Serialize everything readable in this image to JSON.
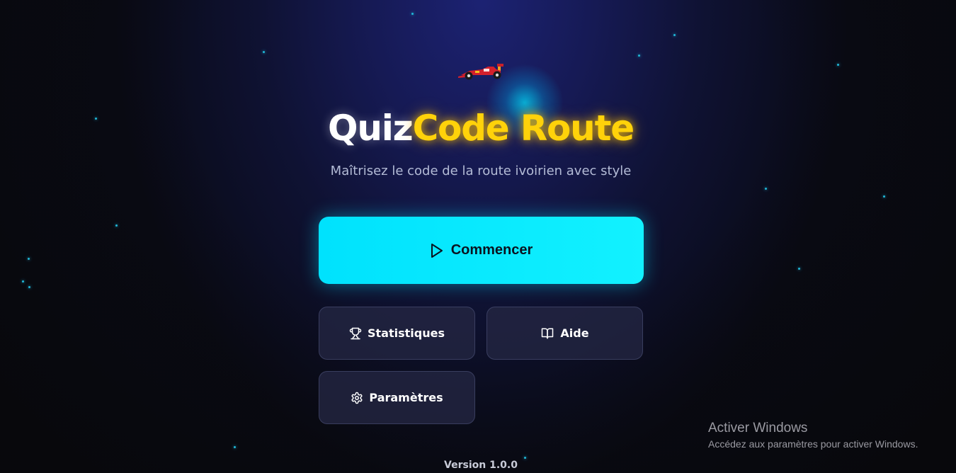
{
  "app": {
    "title_part1": "Quiz",
    "title_part2": "Code Route",
    "subtitle": "Maîtrisez le code de la route ivoirien avec style"
  },
  "menu": {
    "start_label": "Commencer",
    "stats_label": "Statistiques",
    "help_label": "Aide",
    "settings_label": "Paramètres"
  },
  "footer": {
    "version": "Version 1.0.0"
  },
  "windows_watermark": {
    "title": "Activer Windows",
    "subtitle": "Accédez aux paramètres pour activer Windows."
  },
  "icons": {
    "mascot": "race-car-icon",
    "start": "play-icon",
    "stats": "trophy-icon",
    "help": "book-open-icon",
    "settings": "gear-icon"
  },
  "colors": {
    "accent_cyan": "#00e5ff",
    "title_yellow": "#ffd20a",
    "background_navy": "#161a55",
    "button_secondary": "#242642"
  }
}
